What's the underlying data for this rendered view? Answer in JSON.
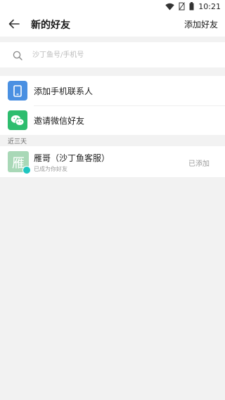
{
  "status_bar": {
    "time": "10:21"
  },
  "header": {
    "back_icon": "arrow-left-icon",
    "title": "新的好友",
    "action_label": "添加好友"
  },
  "search": {
    "placeholder": "沙丁鱼号/手机号",
    "value": "",
    "icon": "search-icon"
  },
  "actions": [
    {
      "label": "添加手机联系人",
      "icon": "phone-icon",
      "color": "#4a90e2"
    },
    {
      "label": "邀请微信好友",
      "icon": "wechat-icon",
      "color": "#2dbd6e"
    }
  ],
  "recent": {
    "header": "近三天",
    "items": [
      {
        "name": "雁哥（沙丁鱼客服）",
        "subtitle": "已成为你好友",
        "status": "已添加",
        "avatar_char": "雁",
        "avatar_color": "#a9d8b7"
      }
    ]
  }
}
